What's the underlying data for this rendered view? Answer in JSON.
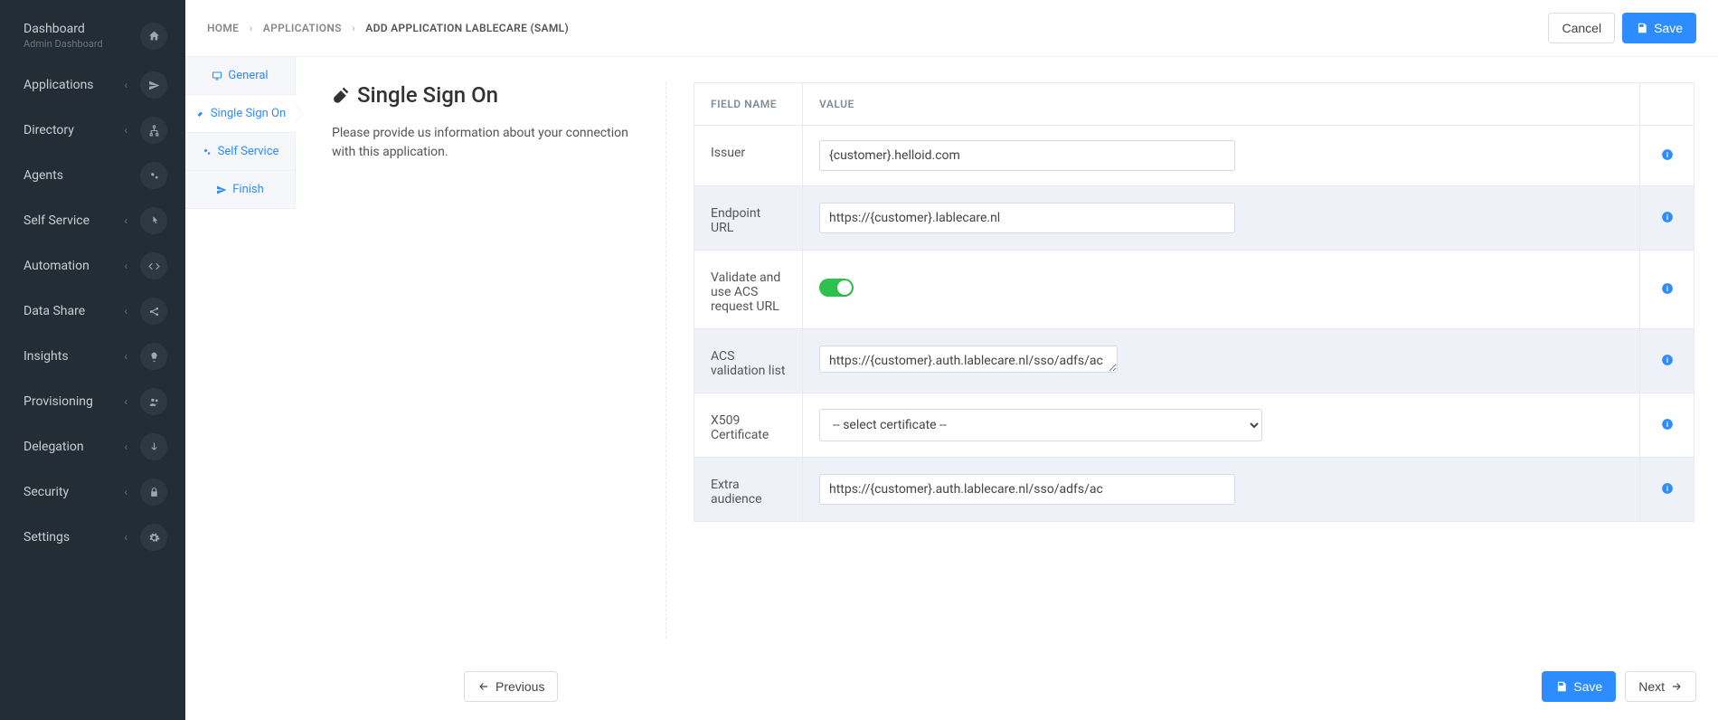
{
  "sidebar": {
    "dashboard": {
      "label": "Dashboard",
      "sub": "Admin Dashboard",
      "icon": "home"
    },
    "items": [
      {
        "label": "Applications",
        "icon": "send"
      },
      {
        "label": "Directory",
        "icon": "sitemap"
      },
      {
        "label": "Agents",
        "icon": "cogs",
        "no_chev": true
      },
      {
        "label": "Self Service",
        "icon": "pointer"
      },
      {
        "label": "Automation",
        "icon": "code"
      },
      {
        "label": "Data Share",
        "icon": "share"
      },
      {
        "label": "Insights",
        "icon": "bulb"
      },
      {
        "label": "Provisioning",
        "icon": "users"
      },
      {
        "label": "Delegation",
        "icon": "down"
      },
      {
        "label": "Security",
        "icon": "lock"
      },
      {
        "label": "Settings",
        "icon": "gear"
      }
    ]
  },
  "breadcrumb": {
    "home": "HOME",
    "apps": "APPLICATIONS",
    "current": "ADD APPLICATION LABLECARE (SAML)"
  },
  "topbar": {
    "cancel": "Cancel",
    "save": "Save"
  },
  "steps": {
    "general": "General",
    "sso": "Single Sign On",
    "selfservice": "Self Service",
    "finish": "Finish"
  },
  "panel": {
    "title": "Single Sign On",
    "desc": "Please provide us information about your connection with this application."
  },
  "table": {
    "head_field": "FIELD NAME",
    "head_value": "VALUE",
    "rows": {
      "issuer": {
        "label": "Issuer",
        "value": "{customer}.helloid.com"
      },
      "endpoint": {
        "label": "Endpoint URL",
        "value": "https://{customer}.lablecare.nl"
      },
      "validate": {
        "label": "Validate and use ACS request URL",
        "value": true
      },
      "acs": {
        "label": "ACS validation list",
        "value": "https://{customer}.auth.lablecare.nl/sso/adfs/ac"
      },
      "x509": {
        "label": "X509 Certificate",
        "value": "-- select certificate --"
      },
      "extra": {
        "label": "Extra audience",
        "value": "https://{customer}.auth.lablecare.nl/sso/adfs/ac"
      }
    }
  },
  "footer": {
    "previous": "Previous",
    "save": "Save",
    "next": "Next"
  }
}
